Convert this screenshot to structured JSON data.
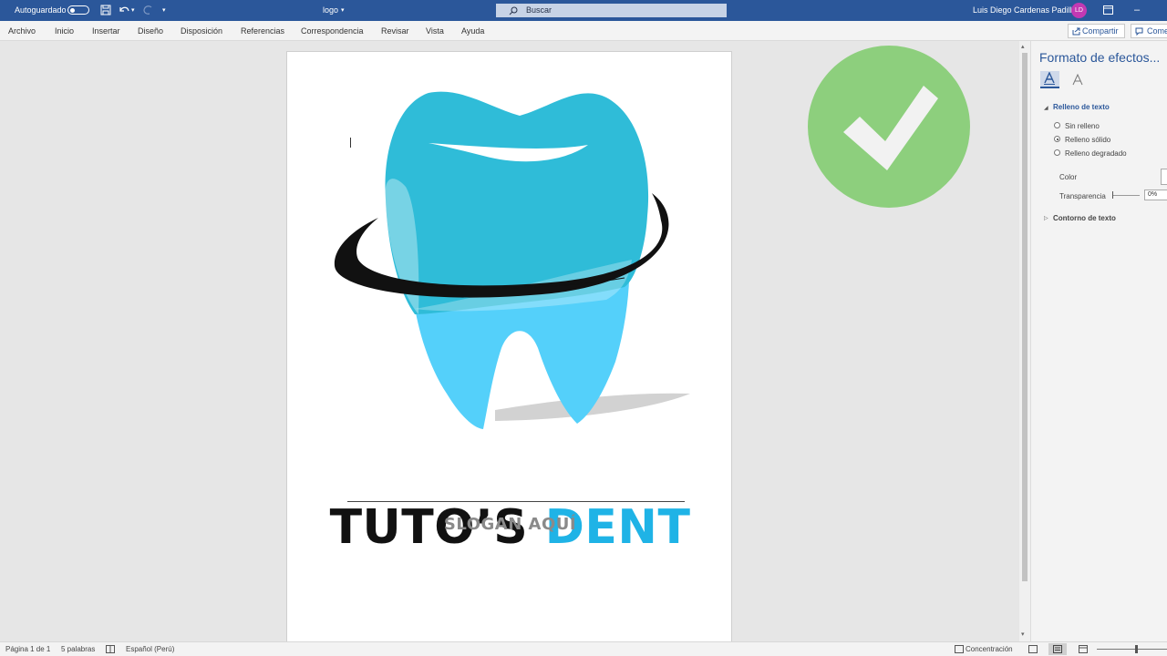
{
  "titlebar": {
    "autosave_label": "Autoguardado",
    "doc_name": "logo",
    "search_placeholder": "Buscar",
    "user_name": "Luis Diego Cardenas Padilla",
    "user_initials": "LD"
  },
  "menu": {
    "items": [
      "Archivo",
      "Inicio",
      "Insertar",
      "Diseño",
      "Disposición",
      "Referencias",
      "Correspondencia",
      "Revisar",
      "Vista",
      "Ayuda"
    ],
    "share_label": "Compartir",
    "comments_label": "Come"
  },
  "document": {
    "brand_part1": "TUTO’S ",
    "brand_part2": "DENT",
    "slogan": "SLOGAN AQUÍ",
    "colors": {
      "tooth_top": "#2fbcd8",
      "tooth_bottom": "#54d0fa",
      "brand_accent": "#1fb3e6",
      "ring": "#111111",
      "check_circle": "#8dcf7d"
    }
  },
  "pane": {
    "title": "Formato de efectos...",
    "section_fill": "Relleno de texto",
    "fill_options": [
      "Sin relleno",
      "Relleno sólido",
      "Relleno degradado"
    ],
    "selected_fill": "Relleno sólido",
    "color_label": "Color",
    "transparency_label": "Transparencia",
    "transparency_value": "0%",
    "section_outline": "Contorno de texto"
  },
  "status": {
    "page": "Página 1 de 1",
    "words": "5 palabras",
    "language": "Español (Perú)",
    "focus": "Concentración"
  }
}
